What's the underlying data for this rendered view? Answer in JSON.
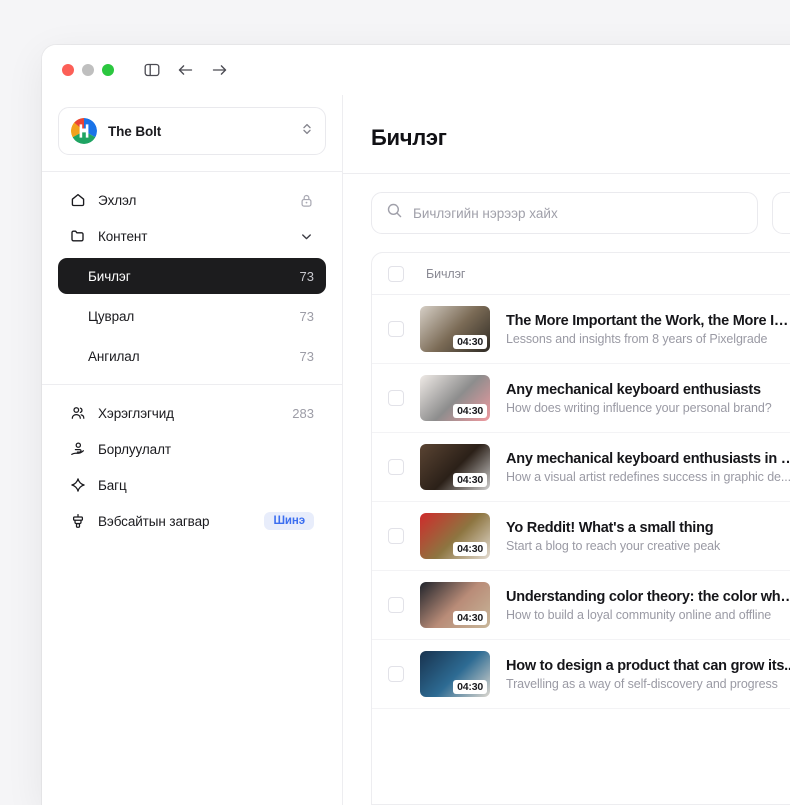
{
  "window": {
    "traffic_lights": [
      {
        "name": "close",
        "color": "#fc5f57"
      },
      {
        "name": "minimize",
        "color": "#bfbfbf"
      },
      {
        "name": "maximize",
        "color": "#2bc73f"
      }
    ],
    "nav_icons": [
      "sidebar-toggle-icon",
      "back-arrow-icon",
      "forward-arrow-icon"
    ]
  },
  "sidebar": {
    "workspace": {
      "name": "The Bolt",
      "logo_letter": "H",
      "switcher_icon": "chevron-up-down-icon"
    },
    "groups": [
      {
        "items": [
          {
            "label": "Эхлэл",
            "icon": "home-icon",
            "trail": "lock-icon",
            "active": false
          },
          {
            "label": "Контент",
            "icon": "folder-icon",
            "trail": "chevron-down-icon",
            "active": false
          },
          {
            "label": "Бичлэг",
            "icon": "",
            "count": "73",
            "active": true,
            "sub": true
          },
          {
            "label": "Цуврал",
            "icon": "",
            "count": "73",
            "active": false,
            "sub": true
          },
          {
            "label": "Ангилал",
            "icon": "",
            "count": "73",
            "active": false,
            "sub": true
          }
        ]
      },
      {
        "divided": true,
        "items": [
          {
            "label": "Хэрэглэгчид",
            "icon": "users-icon",
            "count": "283",
            "active": false
          },
          {
            "label": "Борлуулалт",
            "icon": "sales-hand-icon",
            "active": false
          },
          {
            "label": "Багц",
            "icon": "diamond-icon",
            "active": false
          },
          {
            "label": "Вэбсайтын загвар",
            "icon": "paint-icon",
            "badge": "Шинэ",
            "active": false
          }
        ]
      }
    ]
  },
  "main": {
    "page_title": "Бичлэг",
    "search": {
      "placeholder": "Бичлэгийн нэрээр хайх",
      "value": "",
      "icon": "search-icon"
    },
    "table": {
      "header_checkbox": "select-all-checkbox",
      "column_title": "Бичлэг",
      "rows": [
        {
          "title": "The More Important the Work, the More Im...",
          "subtitle": "Lessons and insights from 8 years of Pixelgrade",
          "duration": "04:30",
          "thumb_colors": [
            "#d6cfc6",
            "#7a6a55",
            "#2e2a24"
          ]
        },
        {
          "title": "Any mechanical keyboard enthusiasts",
          "subtitle": "How does writing influence your personal brand?",
          "duration": "04:30",
          "thumb_colors": [
            "#efeae6",
            "#8d8d8d",
            "#f09aa0"
          ]
        },
        {
          "title": "Any mechanical keyboard enthusiasts in d...",
          "subtitle": "How a visual artist redefines success in graphic de...",
          "duration": "04:30",
          "thumb_colors": [
            "#5a4433",
            "#2b2018",
            "#cfcfcf"
          ]
        },
        {
          "title": "Yo Reddit! What's a small thing",
          "subtitle": "Start a blog to reach your creative peak",
          "duration": "04:30",
          "thumb_colors": [
            "#cf2b2b",
            "#8d7540",
            "#e4dcd2"
          ]
        },
        {
          "title": "Understanding color theory: the color whe...",
          "subtitle": "How to build a loyal community online and offline",
          "duration": "04:30",
          "thumb_colors": [
            "#20242b",
            "#b98c78",
            "#c8b79a"
          ]
        },
        {
          "title": "How to design a product that can grow its...",
          "subtitle": "Travelling as a way of self-discovery and progress",
          "duration": "04:30",
          "thumb_colors": [
            "#18324e",
            "#2d6b93",
            "#ddd8cf"
          ]
        }
      ]
    }
  }
}
